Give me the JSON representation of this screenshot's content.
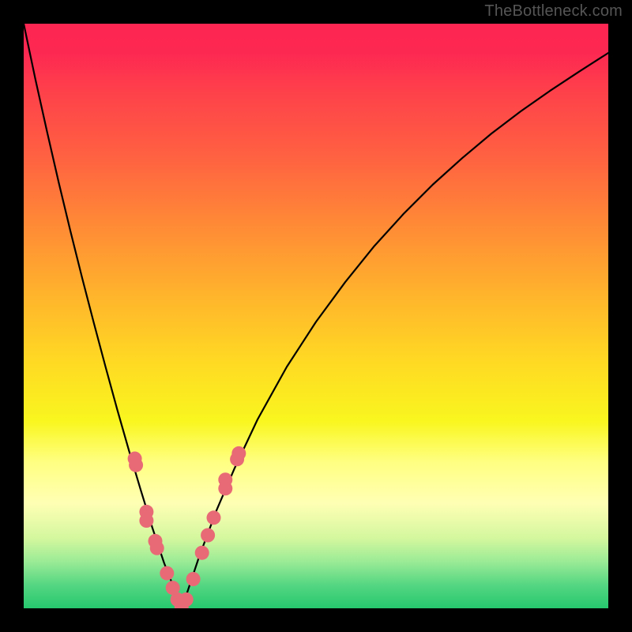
{
  "watermark": "TheBottleneck.com",
  "chart_data": {
    "type": "line",
    "title": "",
    "xlabel": "",
    "ylabel": "",
    "xlim": [
      0,
      1
    ],
    "ylim": [
      0,
      1
    ],
    "vertex_x": 0.27,
    "series": [
      {
        "name": "bottleneck-curve",
        "x": [
          0.0,
          0.02,
          0.04,
          0.06,
          0.08,
          0.1,
          0.12,
          0.14,
          0.16,
          0.18,
          0.2,
          0.22,
          0.24,
          0.26,
          0.27,
          0.28,
          0.3,
          0.33,
          0.36,
          0.4,
          0.45,
          0.5,
          0.55,
          0.6,
          0.65,
          0.7,
          0.75,
          0.8,
          0.85,
          0.9,
          0.95,
          1.0
        ],
        "y": [
          1.0,
          0.905,
          0.815,
          0.728,
          0.645,
          0.565,
          0.488,
          0.413,
          0.34,
          0.27,
          0.203,
          0.138,
          0.078,
          0.027,
          0.0,
          0.028,
          0.088,
          0.168,
          0.238,
          0.323,
          0.413,
          0.49,
          0.558,
          0.62,
          0.675,
          0.725,
          0.77,
          0.812,
          0.85,
          0.885,
          0.918,
          0.95
        ]
      }
    ],
    "markers": {
      "name": "sample-points",
      "x": [
        0.19,
        0.192,
        0.21,
        0.21,
        0.225,
        0.228,
        0.245,
        0.255,
        0.263,
        0.27,
        0.278,
        0.29,
        0.305,
        0.315,
        0.325,
        0.345,
        0.345,
        0.365,
        0.368
      ],
      "y": [
        0.256,
        0.245,
        0.165,
        0.15,
        0.115,
        0.103,
        0.06,
        0.035,
        0.015,
        0.003,
        0.015,
        0.05,
        0.095,
        0.125,
        0.155,
        0.205,
        0.22,
        0.255,
        0.265
      ]
    },
    "marker_color": "#e86a76",
    "curve_color": "#000000"
  }
}
